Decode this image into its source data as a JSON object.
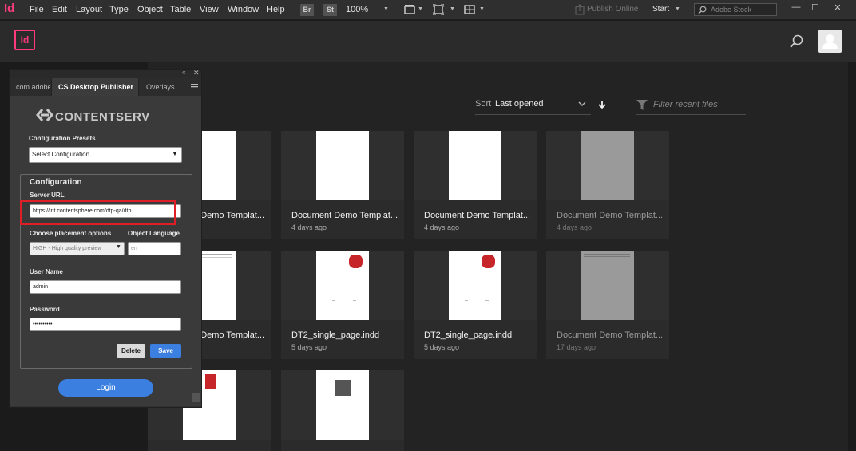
{
  "menubar": {
    "app_glyph": "Id",
    "items": [
      "File",
      "Edit",
      "Layout",
      "Type",
      "Object",
      "Table",
      "View",
      "Window",
      "Help"
    ],
    "bridge": "Br",
    "stock": "St",
    "zoom": "100%",
    "publish_online": "Publish Online",
    "workspace": "Start",
    "search_placeholder": "Adobe Stock"
  },
  "header": {
    "logo": "Id"
  },
  "start": {
    "sort_label": "Sort",
    "sort_value": "Last opened",
    "filter_placeholder": "Filter recent files"
  },
  "files": [
    {
      "title": "Document Demo Templat...",
      "date": "",
      "dim": false
    },
    {
      "title": "Document Demo Templat...",
      "date": "4 days ago",
      "dim": false
    },
    {
      "title": "Document Demo Templat...",
      "date": "4 days ago",
      "dim": false
    },
    {
      "title": "Document Demo Templat...",
      "date": "4 days ago",
      "dim": true
    },
    {
      "title": "Document Demo Templat...",
      "date": "",
      "dim": false
    },
    {
      "title": "DT2_single_page.indd",
      "date": "5 days ago",
      "dim": false
    },
    {
      "title": "DT2_single_page.indd",
      "date": "5 days ago",
      "dim": false
    },
    {
      "title": "Document Demo Templat...",
      "date": "17 days ago",
      "dim": true
    },
    {
      "title": "",
      "date": "",
      "dim": false
    },
    {
      "title": "",
      "date": "",
      "dim": false
    }
  ],
  "panel": {
    "tabs": [
      "com.adobe",
      "CS Desktop Publisher",
      "Overlays"
    ],
    "brand": "CONTENTSERV",
    "presets_label": "Configuration Presets",
    "presets_value": "Select Configuration",
    "config_title": "Configuration",
    "server_label": "Server URL",
    "server_value": "https://int.contentsphere.com/dtp-qa/dtp",
    "placement_label": "Choose placement options",
    "placement_value": "HIGH - High quality preview",
    "language_label": "Object Language",
    "language_value": "en",
    "username_label": "User Name",
    "username_value": "admin",
    "password_label": "Password",
    "password_value": "••••••••••",
    "delete_label": "Delete",
    "save_label": "Save",
    "login_label": "Login"
  },
  "colors": {
    "accent_blue": "#3b7fe0",
    "highlight_red": "#e01e25",
    "indesign_pink": "#ff3b7e"
  }
}
